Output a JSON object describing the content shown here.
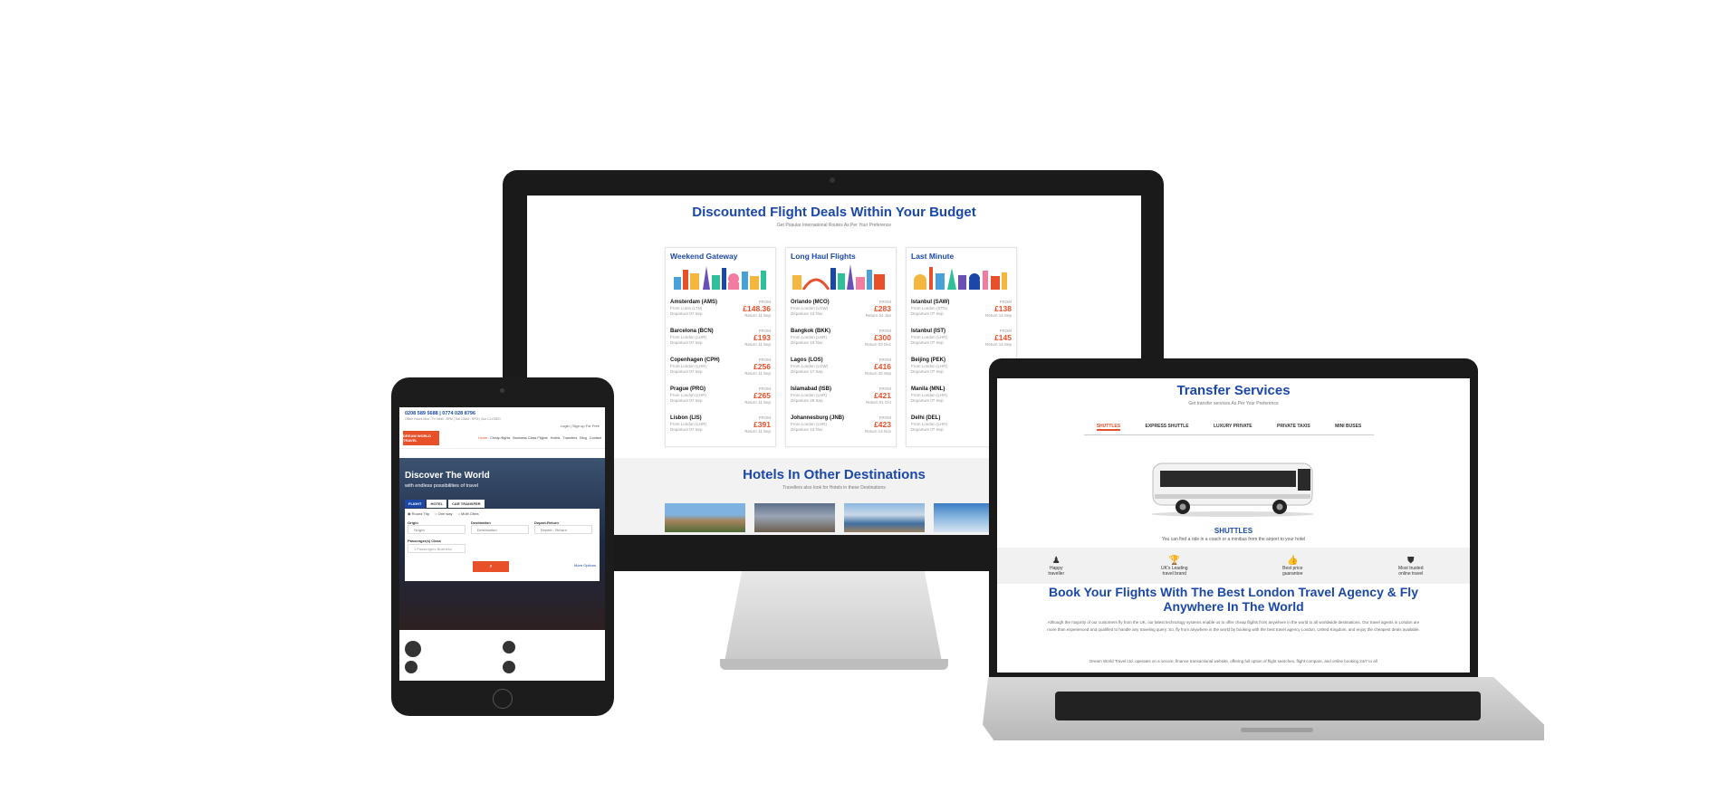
{
  "imac": {
    "title": "Discounted Flight Deals Within Your Budget",
    "subtitle": "Get Popular International Routes As Per Your Preference",
    "columns": [
      {
        "heading": "Weekend Gateway",
        "deals": [
          {
            "city": "Amsterdam (AMS)",
            "from": "From Luton (LTN)",
            "depart": "Departure 07 Sep",
            "label": "FROM",
            "price": "£148.36",
            "return": "Return 11 Sep"
          },
          {
            "city": "Barcelona (BCN)",
            "from": "From London (LHR)",
            "depart": "Departure 07 Sep",
            "label": "FROM",
            "price": "£193",
            "return": "Return 11 Sep"
          },
          {
            "city": "Copenhagen (CPH)",
            "from": "From London (LHR)",
            "depart": "Departure 07 Sep",
            "label": "FROM",
            "price": "£256",
            "return": "Return 11 Sep"
          },
          {
            "city": "Prague (PRG)",
            "from": "From London (LHR)",
            "depart": "Departure 07 Sep",
            "label": "FROM",
            "price": "£265",
            "return": "Return 11 Sep"
          },
          {
            "city": "Lisbon (LIS)",
            "from": "From London (LHR)",
            "depart": "Departure 07 Sep",
            "label": "FROM",
            "price": "£391",
            "return": "Return 11 Sep"
          }
        ]
      },
      {
        "heading": "Long Haul Flights",
        "deals": [
          {
            "city": "Orlando (MCO)",
            "from": "From London (LGW)",
            "depart": "Departure 10 Nov",
            "label": "FROM",
            "price": "£283",
            "return": "Return 24 Jan"
          },
          {
            "city": "Bangkok (BKK)",
            "from": "From London (LHR)",
            "depart": "Departure 18 Nov",
            "label": "FROM",
            "price": "£300",
            "return": "Return 03 Dec"
          },
          {
            "city": "Lagos (LOS)",
            "from": "From London (LGW)",
            "depart": "Departure 17 Sep",
            "label": "FROM",
            "price": "£416",
            "return": "Return 25 Sep"
          },
          {
            "city": "Islamabad (ISB)",
            "from": "From London (LHR)",
            "depart": "Departure 28 Sep",
            "label": "FROM",
            "price": "£421",
            "return": "Return 01 Oct"
          },
          {
            "city": "Johannesburg (JNB)",
            "from": "From London (LHR)",
            "depart": "Departure 10 Nov",
            "label": "FROM",
            "price": "£423",
            "return": "Return 14 Nov"
          }
        ]
      },
      {
        "heading": "Last Minute",
        "deals": [
          {
            "city": "Istanbul (SAW)",
            "from": "From London (STN)",
            "depart": "Departure 07 Sep",
            "label": "FROM",
            "price": "£138",
            "return": "Return 14 Sep"
          },
          {
            "city": "Istanbul (IST)",
            "from": "From London (LHR)",
            "depart": "Departure 07 Sep",
            "label": "FROM",
            "price": "£145",
            "return": "Return 14 Sep"
          },
          {
            "city": "Beijing (PEK)",
            "from": "From London (LHR)",
            "depart": "Departure 07 Sep",
            "label": "",
            "price": "",
            "return": ""
          },
          {
            "city": "Manila (MNL)",
            "from": "From London (LHR)",
            "depart": "Departure 07 Sep",
            "label": "",
            "price": "",
            "return": ""
          },
          {
            "city": "Delhi (DEL)",
            "from": "From London (LHR)",
            "depart": "Departure 07 Sep",
            "label": "",
            "price": "",
            "return": ""
          }
        ]
      }
    ],
    "hotels_title": "Hotels In Other Destinations",
    "hotels_subtitle": "Travellers also look for Hotels in these Destinations"
  },
  "tablet": {
    "phones": "0208 589 5688 | 0774 028 8796",
    "office_hours": "Office Hours Mon - Fri 9AM - 8PM | Sat 10AM - 6PM | Sun CLOSED",
    "login": "Login | Sign up For Free",
    "logo_text": "DREAM WORLD TRAVEL",
    "nav": [
      "Home",
      "Cheap flights",
      "Business Class Flights",
      "Hotels",
      "Transfers",
      "Blog",
      "Contact"
    ],
    "hero_title": "Discover The World",
    "hero_sub": "with endless possibilities of travel",
    "tabs": [
      "FLIGHT",
      "HOTEL",
      "CAR TRANSFER"
    ],
    "trip_types": [
      "Round Trip",
      "One way",
      "Multi Cities"
    ],
    "origin_label": "Origin",
    "origin_placeholder": "Origin",
    "dest_label": "Destination",
    "dest_placeholder": "Destination",
    "dates_label": "Depart-Return",
    "dates_placeholder": "Depart - Return",
    "pax_label": "Passenger(s) Class",
    "pax_value": "1 Passengers Business",
    "more_options": "More Options"
  },
  "laptop": {
    "title": "Transfer Services",
    "subtitle": "Get transfer services As Per Your Preference",
    "tabs": [
      "SHUTTLES",
      "EXPRESS SHUTTLE",
      "LUXURY PRIVATE",
      "PRIVATE TAXIS",
      "MINI BUSES"
    ],
    "shuttle_label": "SHUTTLES",
    "shuttle_desc": "You can find a ride in a coach or a minibus from the airport to your hotel",
    "features": [
      {
        "icon": "travellers-icon",
        "glyph": "♟",
        "line1": "Happy",
        "line2": "traveller"
      },
      {
        "icon": "trophy-icon",
        "glyph": "🏆",
        "line1": "UK's Leading",
        "line2": "travel brand"
      },
      {
        "icon": "thumbs-up-icon",
        "glyph": "👍",
        "line1": "Best price",
        "line2": "guarantee"
      },
      {
        "icon": "shield-icon",
        "glyph": "⛊",
        "line1": "Most trusted",
        "line2": "online travel"
      }
    ],
    "book_title": "Book Your Flights With The Best London Travel Agency & Fly Anywhere In The World",
    "para1": "Although the majority of our customers fly from the UK, our latest technology systems enable us to offer cheap flights from anywhere in the world to all worldwide destinations. Our travel agents in London are more than experienced and qualified to handle any traveling query. So, fly from anywhere in the world by booking with the best travel agency London, United Kingdom, and enjoy the cheapest deals available.",
    "para2": "Dream World Travel Ltd. operates on a secure, finance transactional website, offering full option of flight searches, flight compare, and online booking 24/7 to all"
  }
}
